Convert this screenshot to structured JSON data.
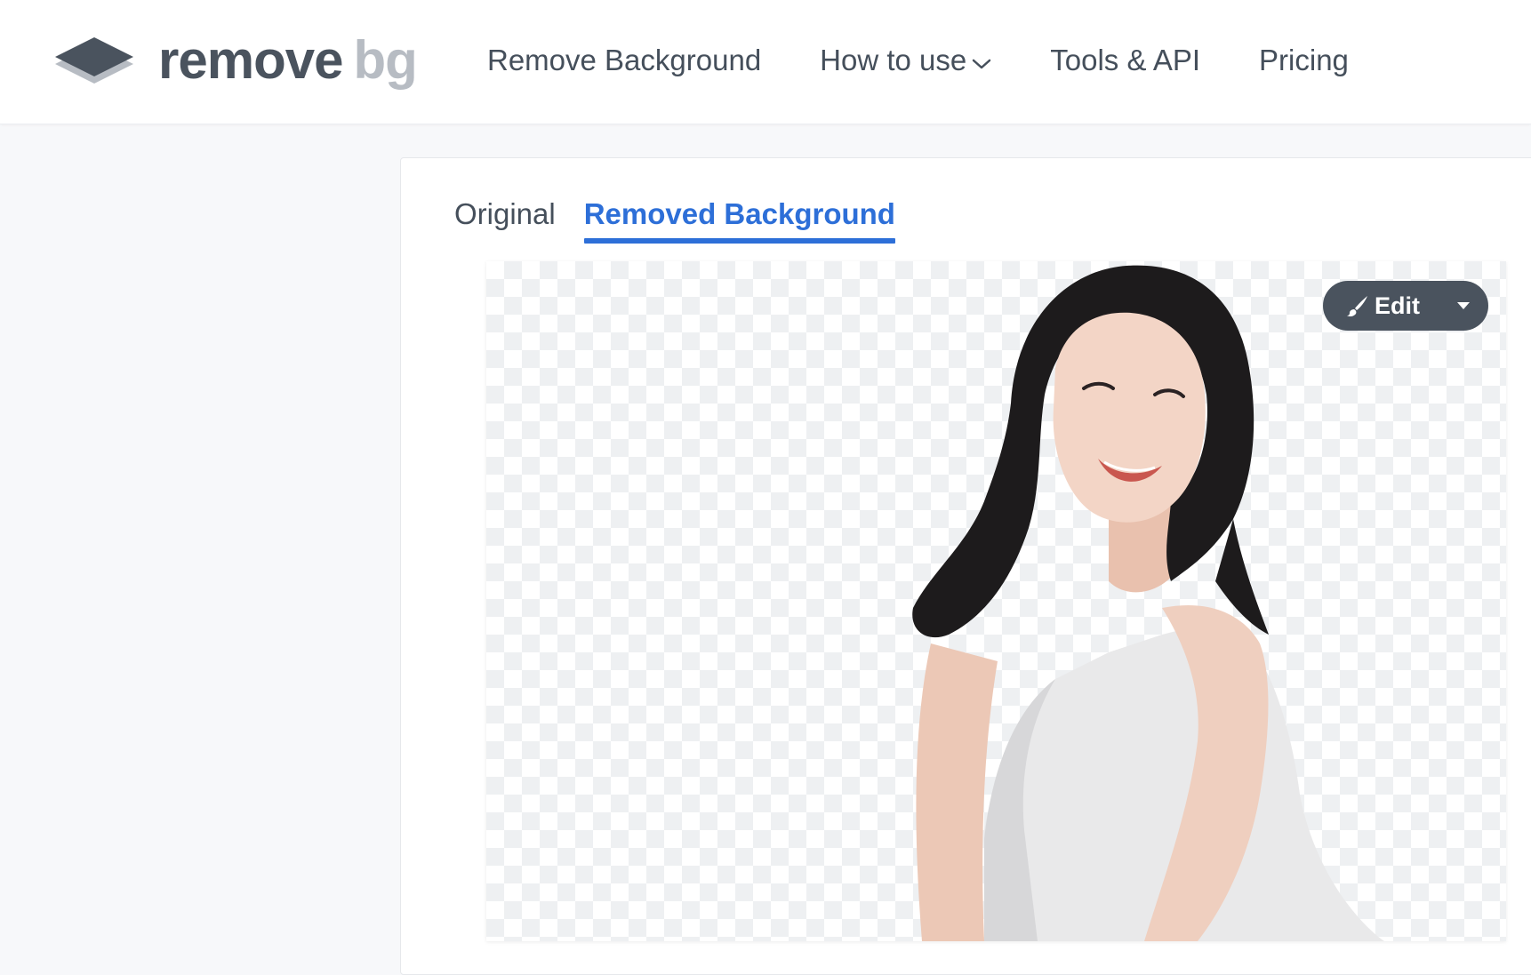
{
  "brand": {
    "name_primary": "remove",
    "name_secondary": "bg",
    "logo_icon": "layers-icon"
  },
  "nav": {
    "items": [
      {
        "label": "Remove Background"
      },
      {
        "label": "How to use",
        "icon": "chevron-down-icon"
      },
      {
        "label": "Tools & API"
      },
      {
        "label": "Pricing"
      }
    ]
  },
  "tabs": [
    {
      "label": "Original",
      "active": false
    },
    {
      "label": "Removed Background",
      "active": true
    }
  ],
  "editor": {
    "edit_label": "Edit",
    "edit_icon": "paint-brush-icon",
    "dropdown_icon": "caret-down-icon"
  },
  "colors": {
    "accent": "#2d6fd8",
    "button": "#4a535e",
    "text": "#454f5b"
  }
}
